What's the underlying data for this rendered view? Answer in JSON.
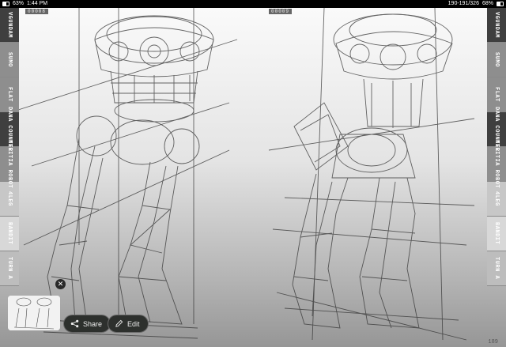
{
  "status_bar": {
    "battery_left": "63%",
    "time": "1:44 PM",
    "page_range": "190-191/326",
    "battery_right": "68%"
  },
  "left_tabs": [
    "VGUNDAM",
    "SUMO",
    "FLAT",
    "DANA COUNTER",
    "MILITIA ROBOT",
    "4LEG",
    "BANDIT",
    "TURN A"
  ],
  "right_tabs": [
    "VGUNDAM",
    "SUMO",
    "FLAT",
    "DANA COUNTER",
    "MILITIA ROBOT",
    "4LEG",
    "BANDIT",
    "TURN A"
  ],
  "page_number_left": "00008",
  "page_number_right": "00009",
  "folio": "189",
  "actions": {
    "share_label": "Share",
    "edit_label": "Edit"
  },
  "icons": {
    "share": "share-icon",
    "edit": "edit-pencil-icon",
    "close": "close-icon"
  }
}
